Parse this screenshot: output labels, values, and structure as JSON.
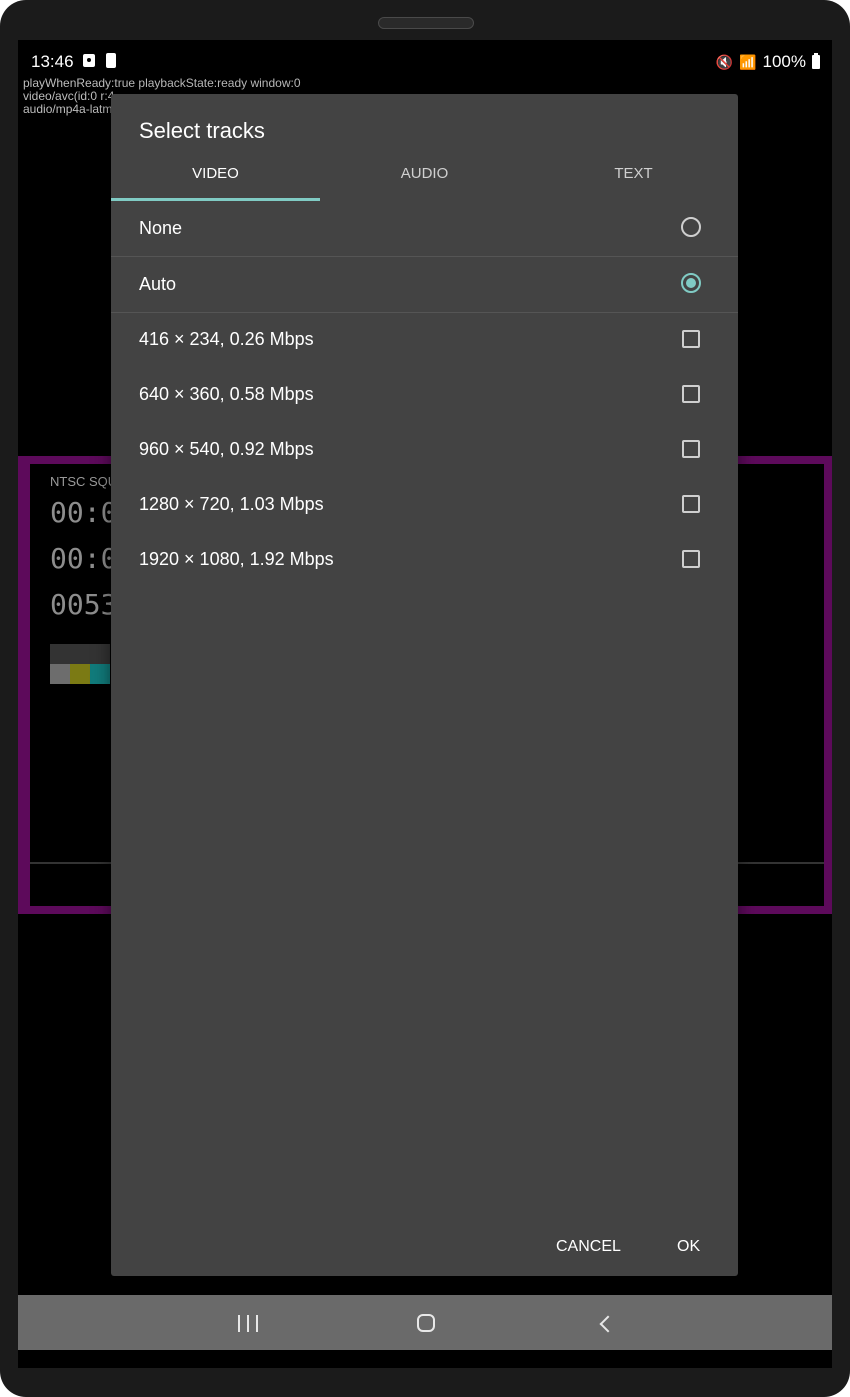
{
  "status_bar": {
    "time": "13:46",
    "battery_percent": "100%",
    "icons": [
      "screenshot-icon",
      "battery-saver-icon",
      "mute-icon",
      "wifi-icon",
      "battery-icon"
    ]
  },
  "debug_overlay": {
    "lines": [
      "playWhenReady:true playbackState:ready window:0",
      "video/avc(id:0 r:4",
      "audio/mp4a-latm"
    ]
  },
  "video_content": {
    "label": "NTSC SQU",
    "timecodes": [
      "00:0",
      "00:0",
      "0053"
    ]
  },
  "dialog": {
    "title": "Select tracks",
    "tabs": [
      {
        "label": "VIDEO",
        "active": true
      },
      {
        "label": "AUDIO",
        "active": false
      },
      {
        "label": "TEXT",
        "active": false
      }
    ],
    "options": [
      {
        "label": "None",
        "control": "radio",
        "selected": false
      },
      {
        "label": "Auto",
        "control": "radio",
        "selected": true
      },
      {
        "label": "416 × 234, 0.26 Mbps",
        "control": "checkbox",
        "checked": false
      },
      {
        "label": "640 × 360, 0.58 Mbps",
        "control": "checkbox",
        "checked": false
      },
      {
        "label": "960 × 540, 0.92 Mbps",
        "control": "checkbox",
        "checked": false
      },
      {
        "label": "1280 × 720, 1.03 Mbps",
        "control": "checkbox",
        "checked": false
      },
      {
        "label": "1920 × 1080, 1.92 Mbps",
        "control": "checkbox",
        "checked": false
      }
    ],
    "cancel_label": "CANCEL",
    "ok_label": "OK",
    "accent_color": "#80cbc4",
    "background_color": "#434343"
  },
  "nav_bar": {
    "buttons": [
      "recents-icon",
      "home-icon",
      "back-icon"
    ]
  }
}
